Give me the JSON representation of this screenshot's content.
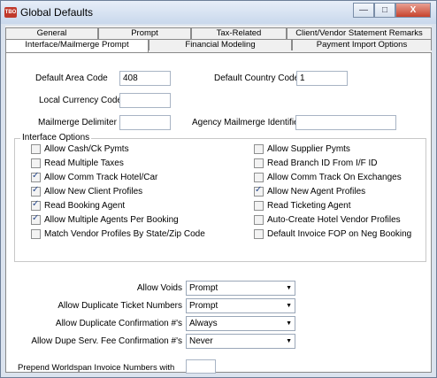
{
  "window": {
    "title": "Global Defaults",
    "app_badge": "TBO"
  },
  "controls": {
    "minimize": "—",
    "maximize": "□",
    "close": "X"
  },
  "tabs_row1": [
    "General",
    "Prompt",
    "Tax-Related",
    "Client/Vendor Statement Remarks"
  ],
  "tabs_row2": [
    "Interface/Mailmerge Prompt",
    "Financial Modeling",
    "Payment Import Options"
  ],
  "fields": {
    "default_area_code": {
      "label": "Default Area Code",
      "value": "408"
    },
    "default_country_code": {
      "label": "Default Country Code",
      "value": "1"
    },
    "local_currency_code": {
      "label": "Local Currency Code",
      "value": ""
    },
    "mailmerge_delimiter": {
      "label": "Mailmerge Delimiter",
      "value": ""
    },
    "agency_mailmerge_identifier": {
      "label": "Agency Mailmerge Identifier",
      "value": ""
    }
  },
  "interface_options": {
    "title": "Interface Options",
    "left": [
      {
        "label": "Allow Cash/Ck Pymts",
        "checked": false
      },
      {
        "label": "Read Multiple Taxes",
        "checked": false
      },
      {
        "label": "Allow Comm Track Hotel/Car",
        "checked": true
      },
      {
        "label": "Allow New Client Profiles",
        "checked": true
      },
      {
        "label": "Read Booking Agent",
        "checked": true
      },
      {
        "label": "Allow Multiple Agents Per Booking",
        "checked": true
      },
      {
        "label": "Match Vendor Profiles By State/Zip Code",
        "checked": false
      }
    ],
    "right": [
      {
        "label": "Allow Supplier Pymts",
        "checked": false
      },
      {
        "label": "Read Branch ID From I/F ID",
        "checked": false
      },
      {
        "label": "Allow Comm Track On Exchanges",
        "checked": false
      },
      {
        "label": "Allow New Agent Profiles",
        "checked": true
      },
      {
        "label": "Read Ticketing Agent",
        "checked": false
      },
      {
        "label": "Auto-Create Hotel Vendor Profiles",
        "checked": false
      },
      {
        "label": "Default Invoice FOP on Neg Booking",
        "checked": false
      }
    ]
  },
  "dropdowns": [
    {
      "label": "Allow Voids",
      "value": "Prompt"
    },
    {
      "label": "Allow Duplicate Ticket Numbers",
      "value": "Prompt"
    },
    {
      "label": "Allow Duplicate Confirmation #'s",
      "value": "Always"
    },
    {
      "label": "Allow Dupe Serv. Fee Confirmation #'s",
      "value": "Never"
    }
  ],
  "prepend": {
    "label": "Prepend Worldspan Invoice Numbers with",
    "value": ""
  }
}
